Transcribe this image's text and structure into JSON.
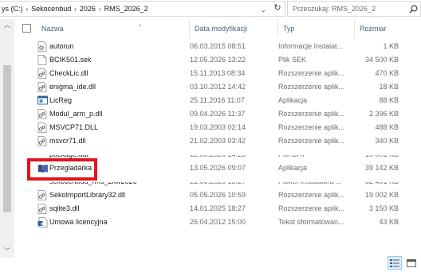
{
  "address": {
    "crumbs": [
      "ys (C:)",
      "Sekocenbud",
      "2026",
      "RMS_2026_2"
    ]
  },
  "search": {
    "placeholder": "Przeszukaj: RMS_2026_2"
  },
  "columns": {
    "name": "Nazwa",
    "date": "Data modyfikacji",
    "type": "Typ",
    "size": "Rozmiar"
  },
  "files": [
    {
      "name": "autorun",
      "date": "06.03.2015 08:51",
      "type": "Informacje Instalat...",
      "size": "1 KB",
      "icon": "settings-file-icon"
    },
    {
      "name": "BCIK501.sek",
      "date": "12.05.2026 13:22",
      "type": "Plik SEK",
      "size": "34 500 KB",
      "icon": "file-icon"
    },
    {
      "name": "CheckLic.dll",
      "date": "15.11.2013 08:34",
      "type": "Rozszerzenie aplik...",
      "size": "470 KB",
      "icon": "dll-icon"
    },
    {
      "name": "enigma_ide.dll",
      "date": "03.10.2012 14:42",
      "type": "Rozszerzenie aplik...",
      "size": "18 KB",
      "icon": "dll-icon"
    },
    {
      "name": "LicReg",
      "date": "25.11.2016 11:07",
      "type": "Aplikacja",
      "size": "88 KB",
      "icon": "application-icon"
    },
    {
      "name": "Modul_arm_p.dll",
      "date": "09.04.2026 11:37",
      "type": "Rozszerzenie aplik...",
      "size": "2 396 KB",
      "icon": "dll-icon"
    },
    {
      "name": "MSVCP71.DLL",
      "date": "19.03.2003 02:14",
      "type": "Rozszerzenie aplik...",
      "size": "488 KB",
      "icon": "dll-icon"
    },
    {
      "name": "msvcr71.dll",
      "date": "21.02.2003 03:42",
      "type": "Rozszerzenie aplik...",
      "size": "340 KB",
      "icon": "dll-icon"
    },
    {
      "name": "package.dat",
      "date": "12.05.2026 14:26",
      "type": "Plik DAT",
      "size": "19 001 KB",
      "icon": "file-icon"
    },
    {
      "name": "Przegladarka",
      "date": "13.05.2026 09:07",
      "type": "Aplikacja",
      "size": "39 142 KB",
      "icon": "book-app-icon"
    },
    {
      "name": "sekocenbud_rms_2kw2026",
      "date": "21.05.2026 15:27",
      "type": "Pakiet Instalatora ...",
      "size": "82 491 KB",
      "icon": "installer-icon"
    },
    {
      "name": "SekoImportLibrary32.dll",
      "date": "05.05.2026 10:59",
      "type": "Rozszerzenie aplik...",
      "size": "19 002 KB",
      "icon": "dll-icon"
    },
    {
      "name": "sqlite3.dll",
      "date": "14.01.2025 18:27",
      "type": "Rozszerzenie aplik...",
      "size": "3 150 KB",
      "icon": "dll-icon"
    },
    {
      "name": "Umowa licencyjna",
      "date": "26.04.2012 15:00",
      "type": "Tekst sformatowan...",
      "size": "43 KB",
      "icon": "document-icon"
    }
  ],
  "colors": {
    "highlight": "#e3141b",
    "header_text": "#4d6082",
    "secondary_text": "#6d6d6d"
  }
}
